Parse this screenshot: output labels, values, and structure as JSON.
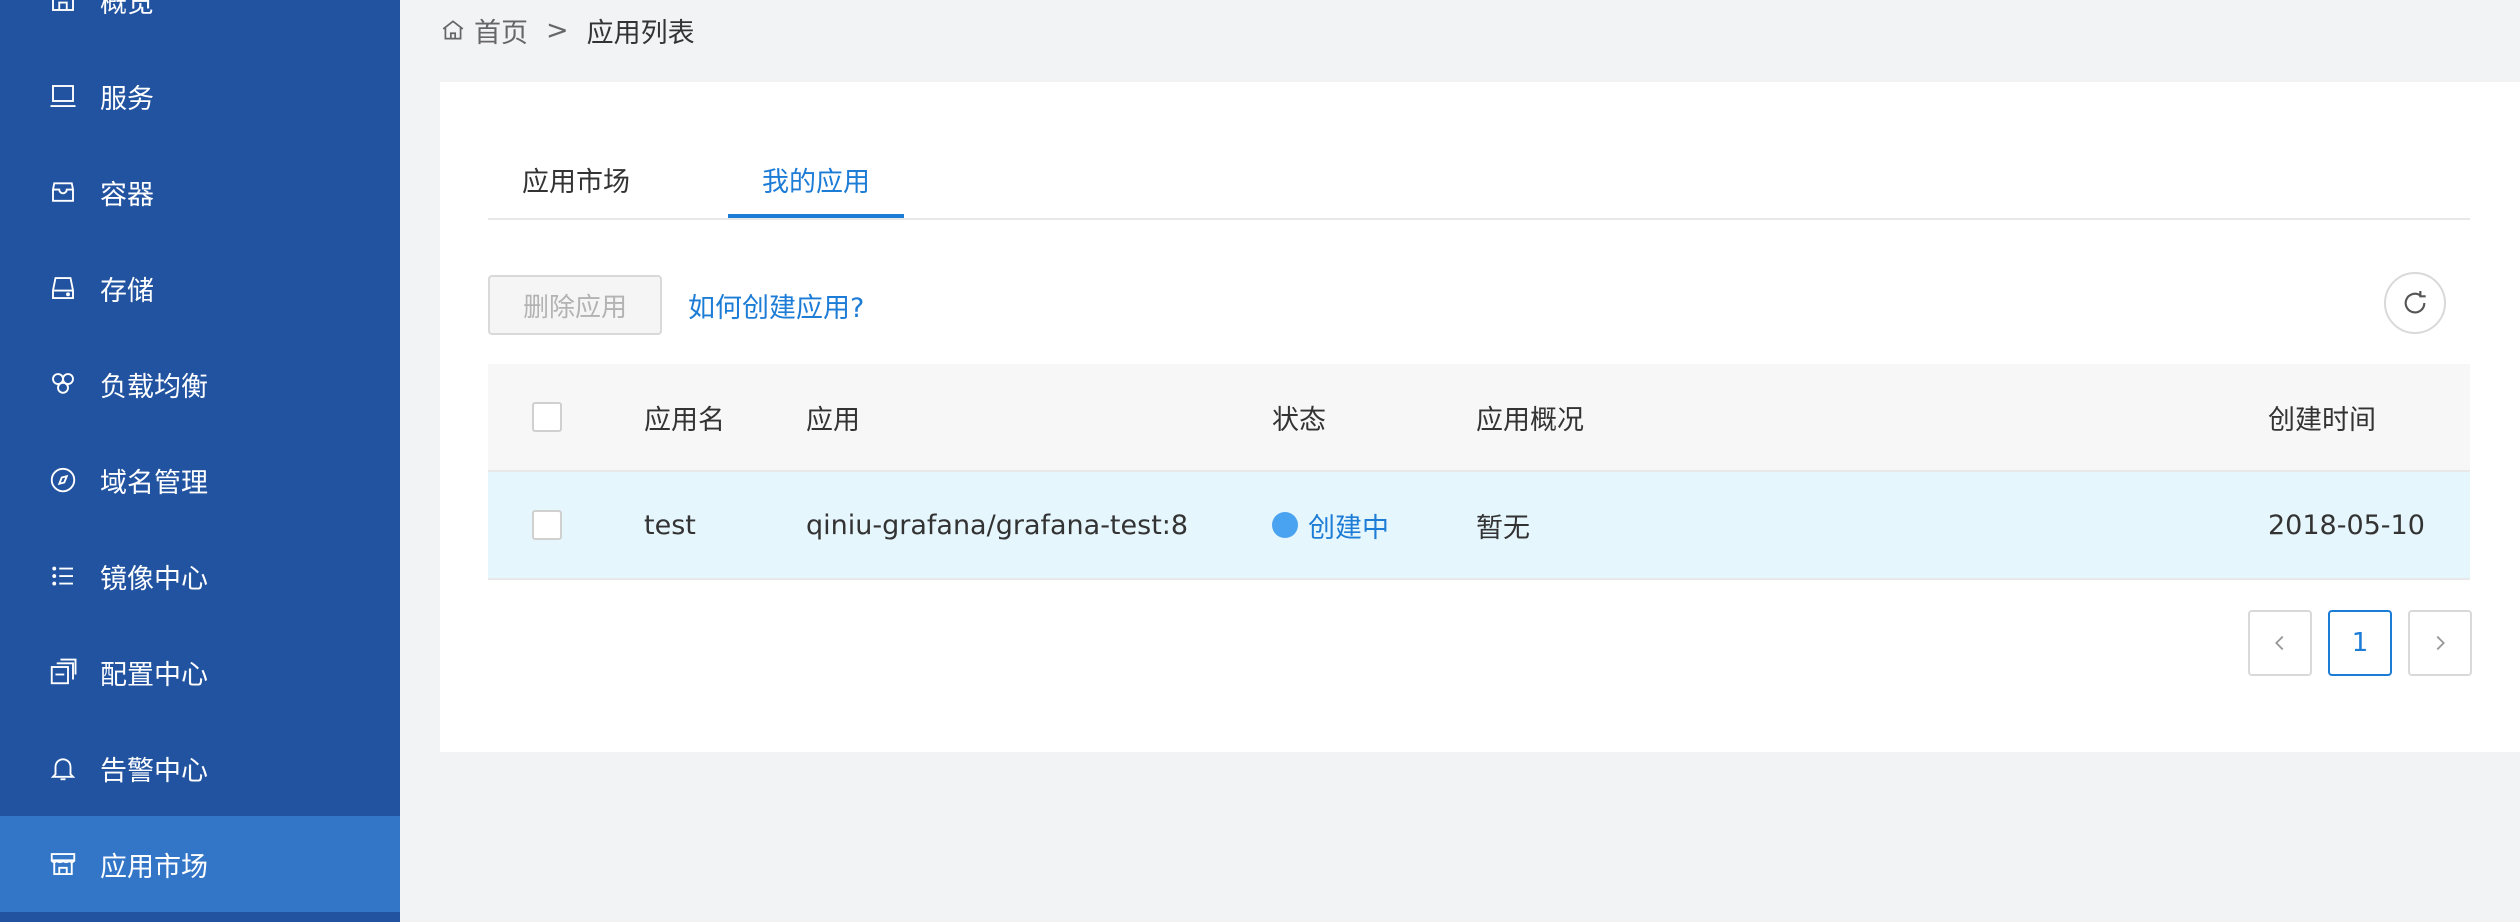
{
  "sidebar": {
    "items": [
      {
        "label": "概览",
        "icon": "overview-icon"
      },
      {
        "label": "服务",
        "icon": "monitor-icon"
      },
      {
        "label": "容器",
        "icon": "container-icon"
      },
      {
        "label": "存储",
        "icon": "storage-icon"
      },
      {
        "label": "负载均衡",
        "icon": "load-balance-icon"
      },
      {
        "label": "域名管理",
        "icon": "compass-icon"
      },
      {
        "label": "镜像中心",
        "icon": "list-icon"
      },
      {
        "label": "配置中心",
        "icon": "config-icon"
      },
      {
        "label": "告警中心",
        "icon": "bell-icon"
      },
      {
        "label": "应用市场",
        "icon": "store-icon",
        "active": true
      }
    ]
  },
  "breadcrumb": {
    "home": "首页",
    "separator": ">",
    "current": "应用列表"
  },
  "tabs": [
    {
      "label": "应用市场"
    },
    {
      "label": "我的应用",
      "active": true
    }
  ],
  "toolbar": {
    "delete_label": "删除应用",
    "help_link": "如何创建应用?"
  },
  "table": {
    "headers": {
      "name": "应用名",
      "app": "应用",
      "status": "状态",
      "summary": "应用概况",
      "created": "创建时间"
    },
    "rows": [
      {
        "name": "test",
        "app": "qiniu-grafana/grafana-test:8",
        "status": "创建中",
        "summary": "暂无",
        "created": "2018-05-10"
      }
    ]
  },
  "pagination": {
    "current": "1"
  },
  "colors": {
    "sidebar_bg": "#2253a0",
    "sidebar_active": "#3376c8",
    "accent": "#1c7cd6",
    "row_highlight": "#e6f6fd",
    "status_dot": "#4aa3f0"
  }
}
